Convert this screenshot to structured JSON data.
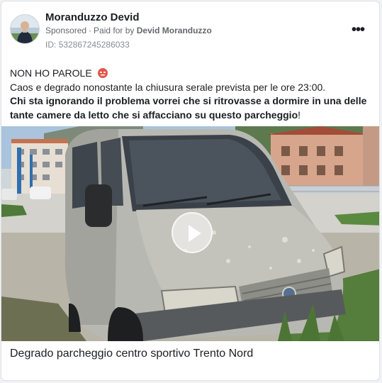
{
  "post": {
    "author": "Moranduzzo Devid",
    "sponsored": "Sponsored",
    "paid_for_prefix": "Paid for by",
    "paid_for_name": "Devid Moranduzzo",
    "ad_id": "ID: 532867245286033",
    "more_icon": "more-dots-icon",
    "text_line1": "NON HO PAROLE",
    "text_line2": "Caos e degrado nonostante la chiusura serale prevista per le ore 23:00.",
    "text_bold": "Chi sta ignorando il problema vorrei che si ritrovasse a dormire in una delle tante camere da letto che si affacciano su questo parcheggio",
    "text_bold_end": "!",
    "media_caption": "Degrado parcheggio centro sportivo Trento Nord"
  }
}
